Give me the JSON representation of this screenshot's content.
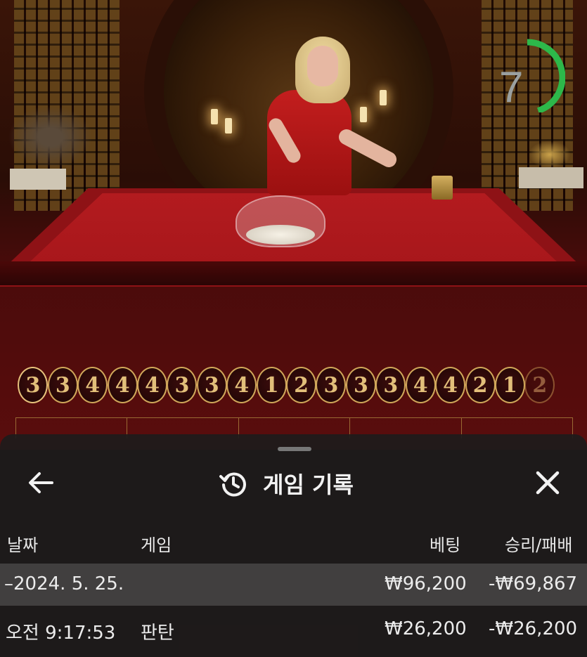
{
  "timer": {
    "seconds": "7",
    "progress": 0.45,
    "color": "#2db84a"
  },
  "results": {
    "items": [
      "3",
      "3",
      "4",
      "4",
      "4",
      "3",
      "3",
      "4",
      "1",
      "2",
      "3",
      "3",
      "3",
      "4",
      "4",
      "2",
      "1",
      "2"
    ]
  },
  "history": {
    "title": "게임 기록",
    "columns": {
      "date": "날짜",
      "game": "게임",
      "bet": "베팅",
      "winloss": "승리/패배"
    },
    "date_row": {
      "date": "–2024. 5. 25.",
      "bet": "₩96,200",
      "winloss": "-₩69,867"
    },
    "entries": [
      {
        "time": "오전 9:17:53",
        "game": "판탄",
        "bet": "₩26,200",
        "winloss": "-₩26,200"
      }
    ]
  }
}
